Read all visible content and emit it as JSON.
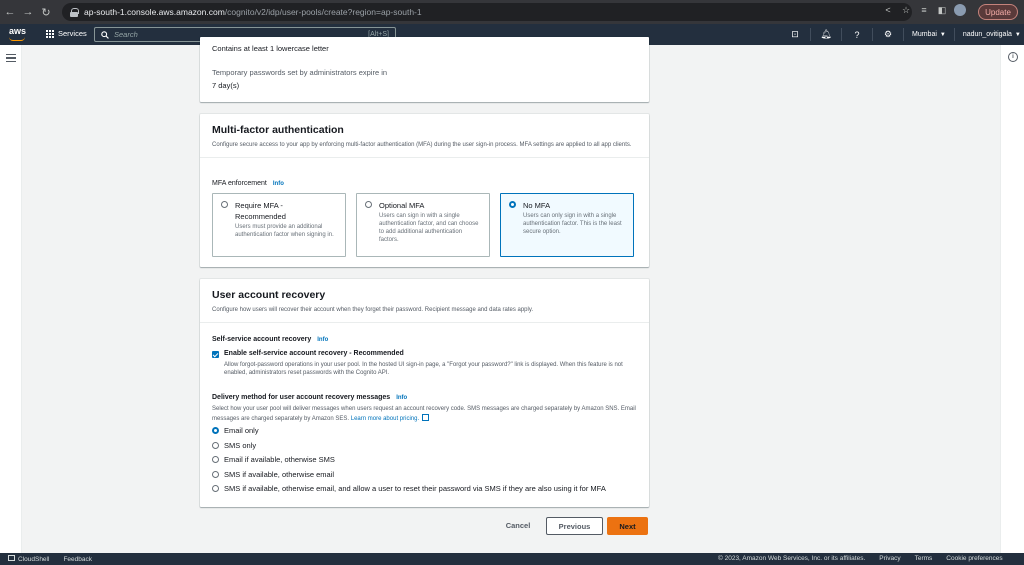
{
  "browser": {
    "url_host": "ap-south-1.console.aws.amazon.com",
    "url_path": "/cognito/v2/idp/user-pools/create?region=ap-south-1",
    "update_label": "Update"
  },
  "aws_header": {
    "logo": "aws",
    "services_label": "Services",
    "search_placeholder": "Search",
    "search_shortcut": "[Alt+S]",
    "region": "Mumbai",
    "user": "nadun_ovitigala"
  },
  "password_panel": {
    "lowercase_rule": "Contains at least 1 lowercase letter",
    "temp_expiry_label": "Temporary passwords set by administrators expire in",
    "temp_expiry_value": "7 day(s)"
  },
  "mfa_panel": {
    "title": "Multi-factor authentication",
    "description": "Configure secure access to your app by enforcing multi-factor authentication (MFA) during the user sign-in process. MFA settings are applied to all app clients.",
    "enforcement_label": "MFA enforcement",
    "info_label": "Info",
    "options": [
      {
        "label_line1": "Require MFA -",
        "label_line2": "Recommended",
        "desc": "Users must provide an additional authentication factor when signing in.",
        "selected": false
      },
      {
        "label_line1": "Optional MFA",
        "desc": "Users can sign in with a single authentication factor, and can choose to add additional authentication factors.",
        "selected": false
      },
      {
        "label_line1": "No MFA",
        "desc": "Users can only sign in with a single authentication factor. This is the least secure option.",
        "selected": true
      }
    ]
  },
  "recovery_panel": {
    "title": "User account recovery",
    "description": "Configure how users will recover their account when they forget their password. Recipient message and data rates apply.",
    "self_service_label": "Self-service account recovery",
    "info_label": "Info",
    "enable_label": "Enable self-service account recovery - Recommended",
    "enable_desc": "Allow forgot-password operations in your user pool. In the hosted UI sign-in page, a \"Forgot your password?\" link is displayed. When this feature is not enabled, administrators reset passwords with the Cognito API.",
    "delivery_label": "Delivery method for user account recovery messages",
    "delivery_desc": "Select how your user pool will deliver messages when users request an account recovery code. SMS messages are charged separately by Amazon SNS. Email messages are charged separately by Amazon SES.",
    "learn_more": "Learn more about pricing.",
    "methods": [
      {
        "label": "Email only",
        "selected": true
      },
      {
        "label": "SMS only",
        "selected": false
      },
      {
        "label": "Email if available, otherwise SMS",
        "selected": false
      },
      {
        "label": "SMS if available, otherwise email",
        "selected": false
      },
      {
        "label": "SMS if available, otherwise email, and allow a user to reset their password via SMS if they are also using it for MFA",
        "selected": false
      }
    ]
  },
  "actions": {
    "cancel": "Cancel",
    "previous": "Previous",
    "next": "Next"
  },
  "footer": {
    "cloudshell": "CloudShell",
    "feedback": "Feedback",
    "copyright": "© 2023, Amazon Web Services, Inc. or its affiliates.",
    "privacy": "Privacy",
    "terms": "Terms",
    "cookies": "Cookie preferences"
  }
}
